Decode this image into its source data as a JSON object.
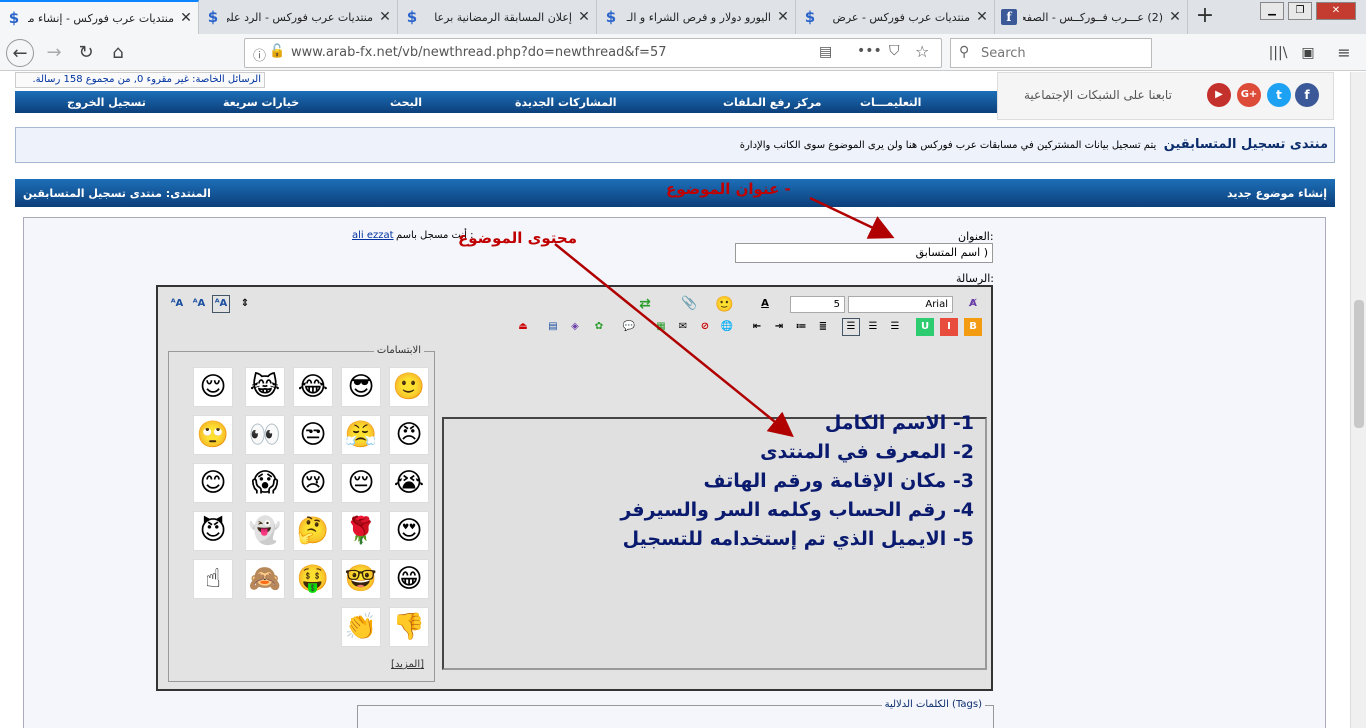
{
  "tabs": [
    {
      "title": "(2) عـــرب فــوركــس - الصفحة",
      "icon": "f"
    },
    {
      "title": "منتديات عرب فوركس - عرض",
      "icon": "$"
    },
    {
      "title": "اليورو دولار و فرص الشراء و الـ",
      "icon": "$"
    },
    {
      "title": "إعلان المسابقة الرمضانية برعا",
      "icon": "$"
    },
    {
      "title": "منتديات عرب فوركس - الرد على",
      "icon": "$"
    },
    {
      "title": "منتديات عرب فوركس - إنشاء مو",
      "icon": "$"
    }
  ],
  "url": "www.arab-fx.net/vb/newthread.php?do=newthread&f=57",
  "search_placeholder": "Search",
  "pm_text": "الرسائل الخاصة: غير مقروء 0, من مجموع 158 رسالة.",
  "social_text": "تابعنا على الشبكات الإجتماعية",
  "social_icons": [
    "f",
    "t",
    "G+",
    "▶"
  ],
  "menu": [
    "التعليمـــات",
    "مركز رفع الملفات",
    "المشاركات الجديدة",
    "البحث",
    "خيارات سريعة",
    "تسجيل الخروج"
  ],
  "forum": {
    "title": "منتدى تسجيل المتسابقين",
    "desc": "يتم تسجيل بيانات المشتركين في مسابقات عرب فوركس هنا ولن يرى الموضوع سوى الكاتب والإدارة"
  },
  "header": {
    "left": "المنتدى: منتدى تسجيل المتسابقين",
    "right": "إنشاء موضوع جديد"
  },
  "form": {
    "title_label": "العنوان:",
    "title_value": "( اسم المتسابق",
    "logged_as": "أنت مسجل باسم :",
    "user": "ali ezzat",
    "msg_label": "الرسالة:",
    "font": "Arial",
    "size": "5",
    "smilies_label": "الابتسامات",
    "more": "[المزيد]",
    "tags_label": "الكلمات الدلالية (Tags)"
  },
  "annotations": {
    "title_note": "عنوان الموضوع -",
    "content_note": "محتوى الموضوع"
  },
  "content_lines": [
    "1- الاسم الكامل",
    "2- المعرف في المنتدى",
    "3- مكان الإقامة ورقم الهاتف",
    "4- رقم الحساب وكلمه السر والسيرفر",
    "5- الايميل الذي تم إستخدامه للتسجيل"
  ],
  "smilies": [
    "🙂",
    "😎",
    "😂",
    "😹",
    "😌",
    "😠",
    "😤",
    "😒",
    "👀",
    "🙄",
    "😭",
    "😔",
    "😢",
    "😱",
    "😊",
    "😍",
    "🌹",
    "🤔",
    "👻",
    "😈",
    "😁",
    "🤓",
    "🤑",
    "🙈",
    "☝",
    "👎",
    "👏"
  ]
}
